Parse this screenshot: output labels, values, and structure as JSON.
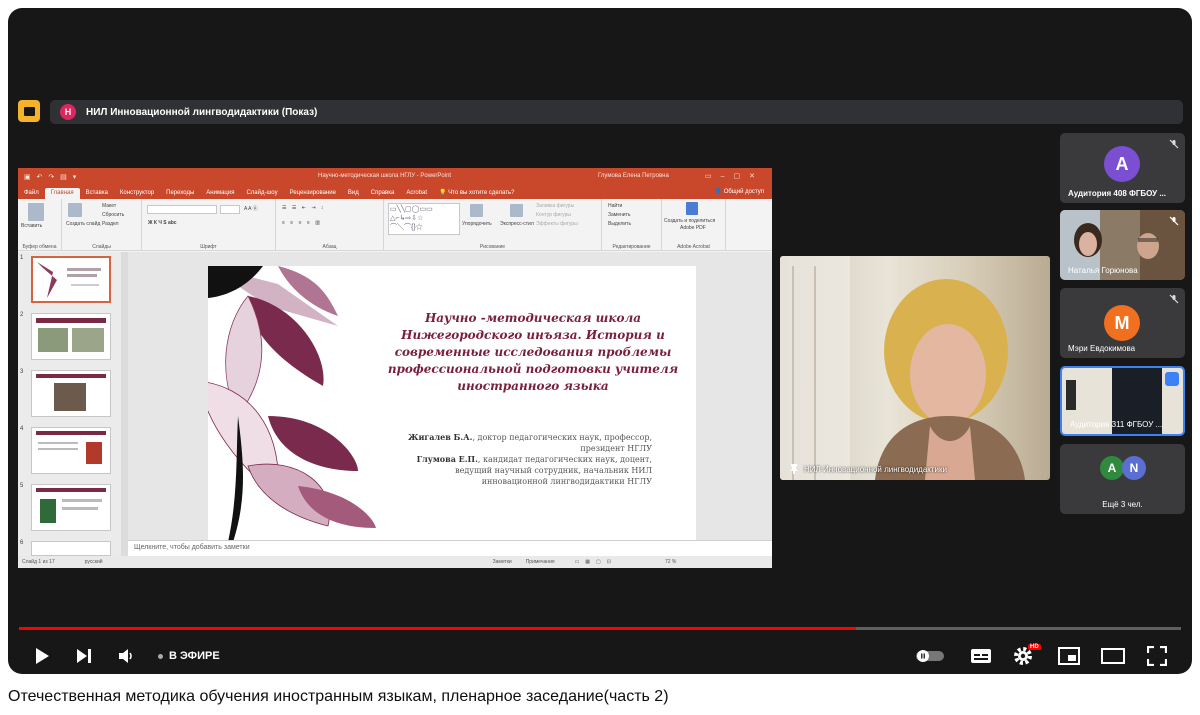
{
  "conference": {
    "avatar_letter": "Н",
    "title": "НИЛ Инновационной лингводидактики (Показ)"
  },
  "powerpoint": {
    "doc_title": "Научно-методическая школа НГЛУ - PowerPoint",
    "user_name": "Глумова Елена Петровна",
    "menu": [
      "Файл",
      "Главная",
      "Вставка",
      "Конструктор",
      "Переходы",
      "Анимация",
      "Слайд-шоу",
      "Рецензирование",
      "Вид",
      "Справка",
      "Acrobat",
      "Что вы хотите сделать?"
    ],
    "active_menu": "Главная",
    "share": "Общий доступ",
    "ribbon": {
      "clipboard_label": "Буфер обмена",
      "paste": "Вставить",
      "slides_label": "Слайды",
      "layout": "Макет",
      "reset": "Сбросить",
      "new_slide": "Создать слайд",
      "section": "Раздел",
      "font_label": "Шрифт",
      "paragraph_label": "Абзац",
      "drawing_label": "Рисование",
      "arrange": "Упорядочить",
      "express_styles": "Экспресс-стили",
      "shape_fill": "Заливка фигуры",
      "shape_outline": "Контур фигуры",
      "shape_effects": "Эффекты фигуры",
      "find": "Найти",
      "replace": "Заменить",
      "select": "Выделить",
      "editing_label": "Редактирование",
      "adobe_create": "Создать и поделиться",
      "adobe_pdf": "Adobe PDF",
      "adobe_label": "Adobe Acrobat"
    },
    "thumb_numbers": [
      "1",
      "2",
      "3",
      "4",
      "5",
      "6"
    ],
    "slide": {
      "title_lines": [
        "Научно -методическая школа",
        "Нижегородского инъяза. История и",
        "современные исследования проблемы",
        "профессиональной подготовки учителя",
        "иностранного языка"
      ],
      "author1_name": "Жигалев Б.А.",
      "author1_line1": ", доктор педагогических наук, профессор,",
      "author1_line2": "президент НГЛУ",
      "author2_name": "Глумова Е.П.",
      "author2_line1": ", кандидат педагогических наук, доцент,",
      "author2_line2": "ведущий научный сотрудник, начальник НИЛ",
      "author2_line3": "инновационной лингводидактики НГЛУ"
    },
    "notes_placeholder": "Щелкните, чтобы добавить заметки",
    "status": {
      "slide_counter": "Слайд 1 из 17",
      "language": "русский",
      "notes_btn": "Заметки",
      "comments_btn": "Примечания",
      "zoom": "72 %"
    }
  },
  "participants": {
    "speaker": "НИЛ Инновационной лингводидактики",
    "tiles": [
      {
        "avatar": "А",
        "name": "Аудитория 408 ФГБОУ ...",
        "color": "#7b4fd1"
      },
      {
        "name": "Наталья Горюнова"
      },
      {
        "avatar": "М",
        "name": "Мэри Евдокимова",
        "color": "#f0701f"
      },
      {
        "name": "Аудитория 311 ФГБОУ ..."
      },
      {
        "avatars": [
          "А",
          "N"
        ],
        "colors": [
          "#2f8a3d",
          "#5a6fd1"
        ],
        "name": "Ещё 3 чел."
      }
    ]
  },
  "player": {
    "live_label": "В ЭФИРЕ",
    "progress_fraction": 0.72,
    "hd_badge": "HD"
  },
  "video_caption": "Отечественная методика обучения иностранным языкам, пленарное заседание(часть 2)"
}
